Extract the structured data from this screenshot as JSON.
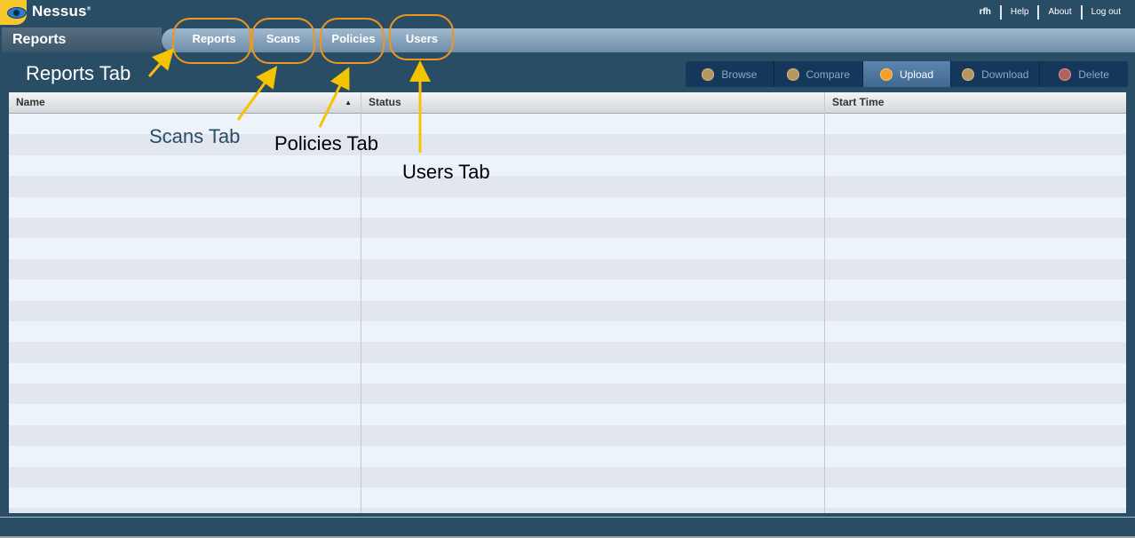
{
  "app": {
    "logo_text": "Nessus",
    "logo_mark": "®"
  },
  "top_links": {
    "user": "rfh",
    "help": "Help",
    "about": "About",
    "logout": "Log out"
  },
  "section_title": "Reports",
  "tabs": [
    {
      "label": "Reports"
    },
    {
      "label": "Scans"
    },
    {
      "label": "Policies"
    },
    {
      "label": "Users"
    }
  ],
  "toolbar": {
    "buttons": [
      {
        "label": "Browse",
        "icon": "browse-icon",
        "active": false
      },
      {
        "label": "Compare",
        "icon": "compare-icon",
        "active": false
      },
      {
        "label": "Upload",
        "icon": "upload-icon",
        "active": true
      },
      {
        "label": "Download",
        "icon": "download-icon",
        "active": false
      },
      {
        "label": "Delete",
        "icon": "delete-icon",
        "active": false
      }
    ]
  },
  "table": {
    "columns": [
      {
        "label": "Name",
        "sort": "ascending"
      },
      {
        "label": "Status"
      },
      {
        "label": "Start Time"
      }
    ],
    "rows": []
  },
  "annotations": {
    "reports_tab": "Reports Tab",
    "scans_tab": "Scans Tab",
    "policies_tab": "Policies Tab",
    "users_tab": "Users Tab"
  },
  "colors": {
    "background": "#2a4d66",
    "annotation_ring": "#f0961e",
    "annotation_arrow": "#f5c400",
    "toolbar_bg": "#15385a",
    "active_button": "#4e7aa2"
  }
}
